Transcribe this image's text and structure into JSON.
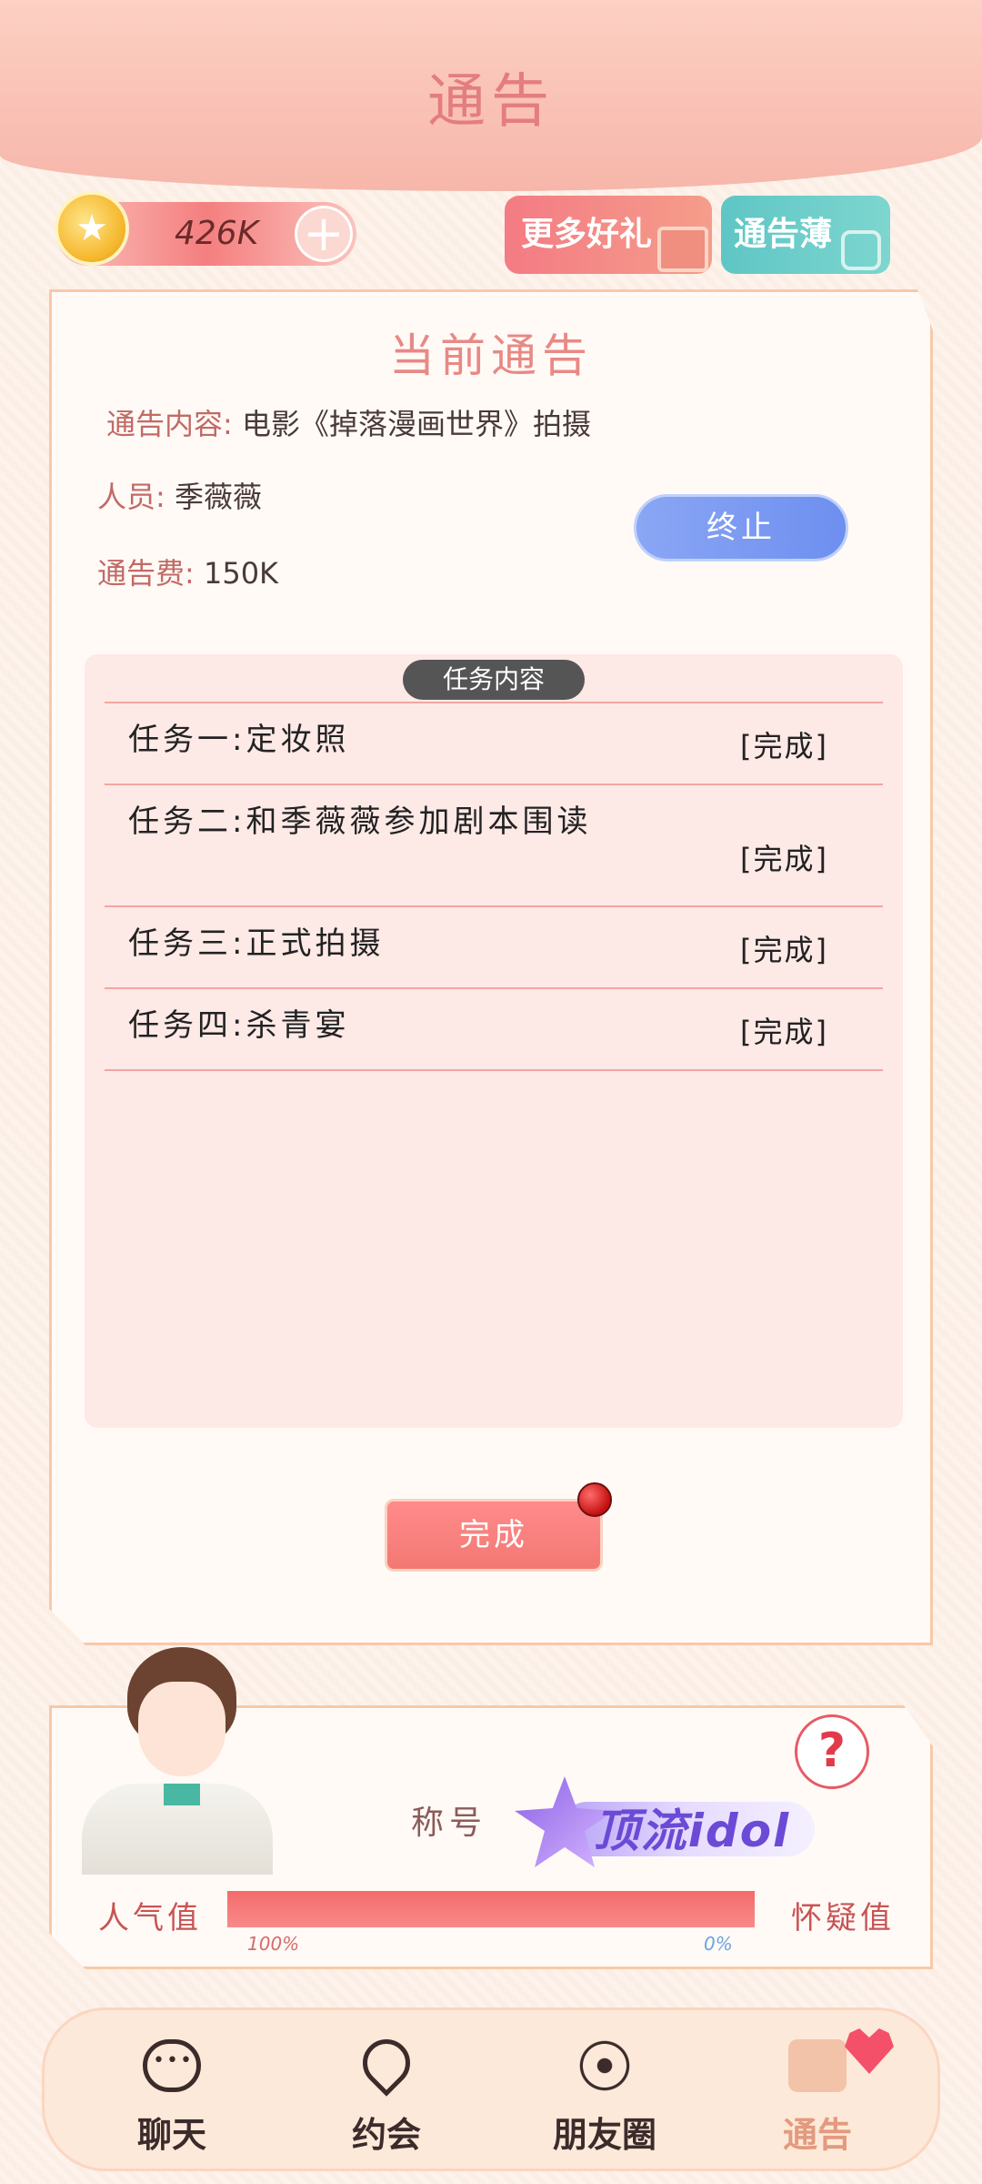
{
  "header": {
    "title": "通告"
  },
  "currency": {
    "value": "426K",
    "plus_symbol": "+"
  },
  "top_buttons": {
    "more_gifts": "更多好礼",
    "notice_book": "通告薄"
  },
  "current_notice": {
    "title": "当前通告",
    "content_label": "通告内容:",
    "content_value": "电影《掉落漫画世界》拍摄",
    "person_label": "人员:",
    "person_value": "季薇薇",
    "fee_label": "通告费:",
    "fee_value": "150K",
    "stop_button": "终止"
  },
  "tasks": {
    "header": "任务内容",
    "items": [
      {
        "label": "任务一:定妆照",
        "status": "[完成]"
      },
      {
        "label": "任务二:和季薇薇参加剧本围读",
        "status": "[完成]"
      },
      {
        "label": "任务三:正式拍摄",
        "status": "[完成]"
      },
      {
        "label": "任务四:杀青宴",
        "status": "[完成]"
      }
    ]
  },
  "complete_button": "完成",
  "status": {
    "title_label": "称号",
    "badge_text": "顶流idol",
    "help_symbol": "?",
    "left_meter_label": "人气值",
    "right_meter_label": "怀疑值",
    "left_percent": "100%",
    "right_percent": "0%",
    "popularity_fraction": 1.0
  },
  "nav": {
    "items": [
      {
        "label": "聊天",
        "icon": "chat-bubble-icon"
      },
      {
        "label": "约会",
        "icon": "heart-icon"
      },
      {
        "label": "朋友圈",
        "icon": "flower-icon"
      },
      {
        "label": "通告",
        "icon": "camera-icon",
        "active": true
      }
    ]
  },
  "colors": {
    "accent": "#f47f7f",
    "stop_blue": "#6e8ff0",
    "badge_purple": "#6b4ad6"
  }
}
